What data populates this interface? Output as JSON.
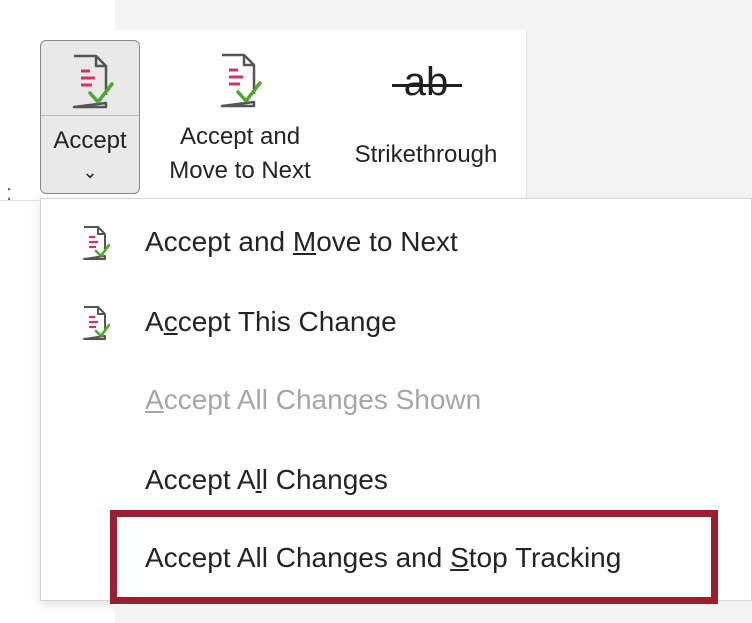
{
  "ribbon": {
    "accept": {
      "label": "Accept",
      "chevron": "⌄",
      "icon": "doc-check-icon"
    },
    "accept_next": {
      "label_line1": "Accept and",
      "label_line2": "Move to Next",
      "icon": "doc-check-icon"
    },
    "strikethrough": {
      "glyph": "ab",
      "label": "Strikethrough"
    }
  },
  "menu": {
    "items": [
      {
        "label_pre": "Accept and ",
        "label_key": "M",
        "label_post": "ove to Next",
        "enabled": true,
        "icon": "doc-check-icon"
      },
      {
        "label_pre": "A",
        "label_key": "c",
        "label_post": "cept This Change",
        "enabled": true,
        "icon": "doc-check-icon"
      },
      {
        "label_pre": "",
        "label_key": "A",
        "label_post": "ccept All Changes Shown",
        "enabled": false
      },
      {
        "label_pre": "Accept A",
        "label_key": "l",
        "label_post": "l Changes",
        "enabled": true
      },
      {
        "label_pre": "Accept All Changes and ",
        "label_key": "S",
        "label_post": "top Tracking",
        "enabled": true
      }
    ]
  },
  "colors": {
    "highlight": "#9b1f2e",
    "check_green": "#4ea72e",
    "doc_pink": "#d6306b"
  }
}
